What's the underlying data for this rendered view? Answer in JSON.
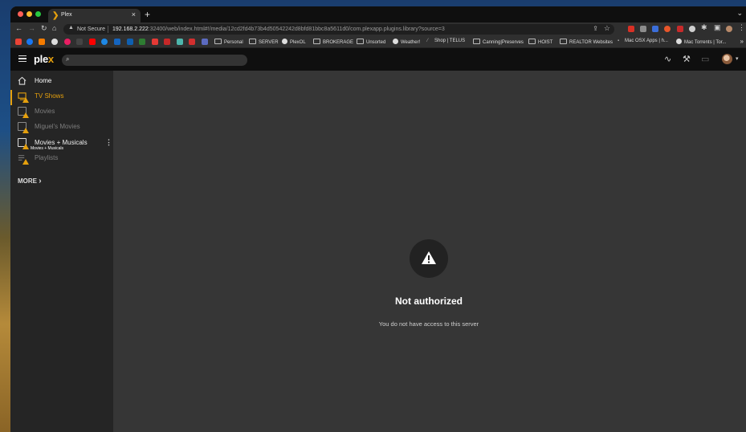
{
  "browser": {
    "tab_title": "Plex",
    "tab_close": "×",
    "new_tab": "+",
    "security_label": "Not Secure",
    "url_host": "192.168.2.222",
    "url_path": ":32400/web/index.html#!/media/12cd2fd4b73b4d50542242d8bfd81bbc8a5611d0/com.plexapp.plugins.library?source=3"
  },
  "bookmarks": [
    {
      "label": "Personal",
      "kind": "folder"
    },
    {
      "label": "SERVER",
      "kind": "folder"
    },
    {
      "label": "PlexOL",
      "kind": "globe"
    },
    {
      "label": "BROKERAGE",
      "kind": "folder"
    },
    {
      "label": "Unsorted",
      "kind": "folder"
    },
    {
      "label": "Weather!",
      "kind": "globe"
    },
    {
      "label": "Shop | TELUS",
      "kind": "leaf"
    },
    {
      "label": "Canning|Preserves",
      "kind": "folder"
    },
    {
      "label": "HOIST",
      "kind": "folder"
    },
    {
      "label": "REALTOR Websites",
      "kind": "folder"
    },
    {
      "label": "Mac OSX Apps | h...",
      "kind": "leaf"
    },
    {
      "label": "Mac Torrents | Tor...",
      "kind": "globe"
    }
  ],
  "bookmarks_more": "»",
  "plex": {
    "logo_main": "ple",
    "logo_accent": "x",
    "sidebar": {
      "items": [
        {
          "label": "Home"
        },
        {
          "label": "TV Shows"
        },
        {
          "label": "Movies"
        },
        {
          "label": "Miguel's Movies"
        },
        {
          "label": "Movies + Musicals"
        },
        {
          "label": "Playlists"
        }
      ],
      "tooltip": "Movies + Musicals",
      "more": "MORE"
    },
    "error": {
      "title": "Not authorized",
      "message": "You do not have access to this server"
    }
  },
  "colors": {
    "accent": "#e5a00d",
    "sidebar_bg": "#252525",
    "main_bg": "#363636",
    "topbar_bg": "#0f0f0f"
  }
}
